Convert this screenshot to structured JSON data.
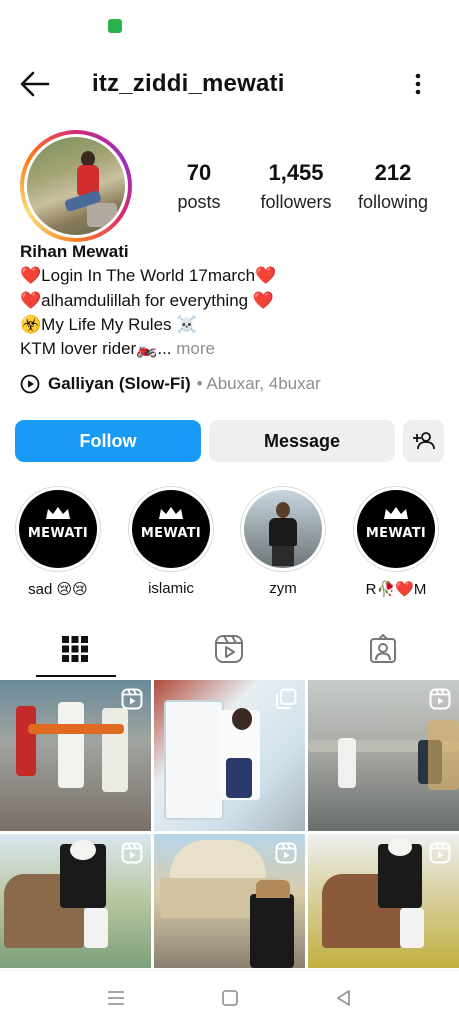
{
  "header": {
    "username": "itz_ziddi_mewati"
  },
  "stats": {
    "posts_value": "70",
    "posts_label": "posts",
    "followers_value": "1,455",
    "followers_label": "followers",
    "following_value": "212",
    "following_label": "following"
  },
  "bio": {
    "name": "Rihan Mewati",
    "line1": "❤️Login In The World 17march❤️",
    "line2": "❤️alhamdulillah for everything ❤️",
    "line3": "☣️My Life My Rules ☠️",
    "line4": " KTM lover rider🏍️...",
    "more": " more"
  },
  "music": {
    "song": "Galliyan (Slow-Fi)",
    "artist": "• Abuxar, 4buxar"
  },
  "actions": {
    "follow_label": "Follow",
    "message_label": "Message"
  },
  "highlights": [
    {
      "label": "sad 😢😢",
      "cover_text": "MEWATI"
    },
    {
      "label": "islamic",
      "cover_text": "MEWATI"
    },
    {
      "label": "zym",
      "cover_text": ""
    },
    {
      "label": "R🥀❤️M",
      "cover_text": "MEWATI"
    }
  ],
  "tabs": [
    "posts-grid",
    "reels",
    "tagged"
  ],
  "colors": {
    "follow_button": "#1a9af7",
    "secondary_button": "#efefef",
    "muted_text": "#8e8e8e"
  },
  "icons": {
    "back": "arrow-left-icon",
    "more": "more-vertical-icon",
    "add_user": "add-user-icon",
    "music_play": "play-circle-icon",
    "grid_tab": "grid-icon",
    "reels_tab": "reels-icon",
    "tagged_tab": "tagged-icon",
    "reel_badge": "reel-badge-icon"
  }
}
